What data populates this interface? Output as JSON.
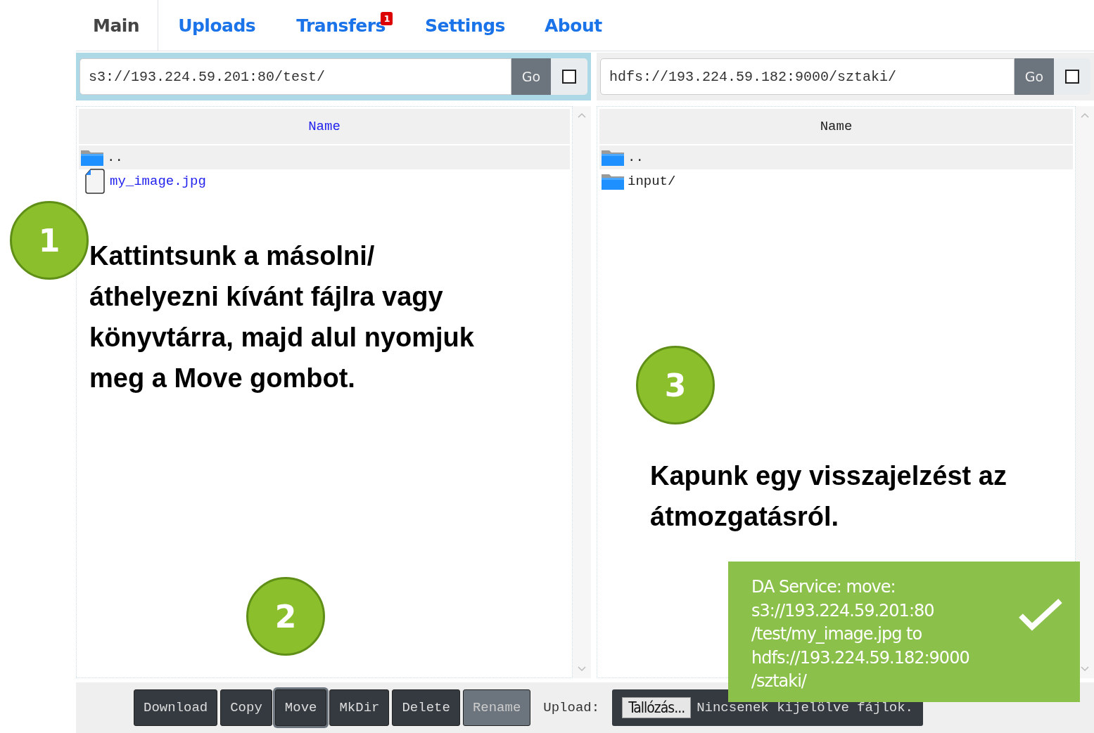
{
  "tabs": [
    {
      "label": "Main",
      "selected": true
    },
    {
      "label": "Uploads",
      "selected": false
    },
    {
      "label": "Transfers",
      "selected": false,
      "badge": "1"
    },
    {
      "label": "Settings",
      "selected": false
    },
    {
      "label": "About",
      "selected": false
    }
  ],
  "panes": [
    {
      "path": "s3://193.224.59.201:80/test/",
      "go": "Go",
      "checked": false,
      "active": true,
      "column": "Name",
      "rows": [
        {
          "name": "..",
          "kind": "folder"
        },
        {
          "name": "my_image.jpg",
          "kind": "file"
        }
      ]
    },
    {
      "path": "hdfs://193.224.59.182:9000/sztaki/",
      "go": "Go",
      "checked": false,
      "active": false,
      "column": "Name",
      "rows": [
        {
          "name": "..",
          "kind": "folder"
        },
        {
          "name": "input/",
          "kind": "folder"
        }
      ]
    }
  ],
  "buttons": [
    {
      "label": "Download",
      "disabled": false,
      "focused": false
    },
    {
      "label": "Copy",
      "disabled": false,
      "focused": false
    },
    {
      "label": "Move",
      "disabled": false,
      "focused": true
    },
    {
      "label": "MkDir",
      "disabled": false,
      "focused": false
    },
    {
      "label": "Delete",
      "disabled": false,
      "focused": false
    },
    {
      "label": "Rename",
      "disabled": true,
      "focused": false
    }
  ],
  "upload": {
    "label": "Upload:",
    "button": "Tallózás...",
    "status": "Nincsenek kijelölve fájlok."
  },
  "annotations": [
    {
      "number": "1",
      "text": "Kattintsunk a másolni/áthelyezni kívánt fájlra vagy könyvtárra, majd alul nyomjuk meg a Move gombot."
    },
    {
      "number": "2"
    },
    {
      "number": "3",
      "text": "Kapunk egy visszajelzést az átmozgatásról."
    }
  ],
  "toast": {
    "text": "DA Service: move:\ns3://193.224.59.201:80\n/test/my_image.jpg to\nhdfs://193.224.59.182:9000\n/sztaki/",
    "success": true
  }
}
